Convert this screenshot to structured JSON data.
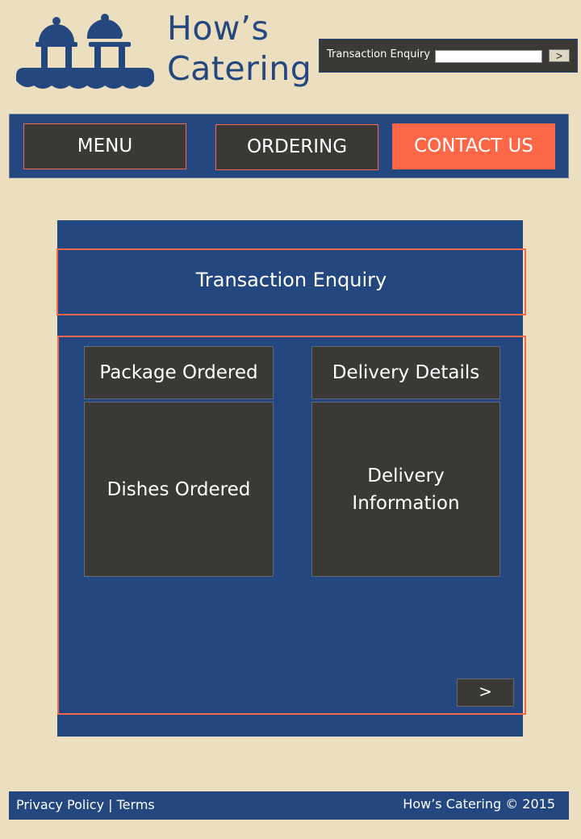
{
  "header": {
    "brand_line1": "How’s",
    "brand_line2": "Catering",
    "search": {
      "label": "Transaction Enquiry",
      "value": "",
      "go_label": ">"
    }
  },
  "nav": {
    "menu": "MENU",
    "ordering": "ORDERING",
    "contact": "CONTACT US"
  },
  "main": {
    "title": "Transaction Enquiry",
    "tiles": {
      "package": "Package Ordered",
      "delivery": "Delivery Details",
      "dishes": "Dishes Ordered",
      "info": "Delivery\nInformation"
    },
    "next_label": ">"
  },
  "footer": {
    "privacy": "Privacy Policy",
    "separator": "|",
    "terms": "Terms",
    "copyright": "How’s Catering © 2015"
  },
  "colors": {
    "background": "#ebdfbf",
    "primary_blue": "#23477e",
    "dark": "#3a3935",
    "accent": "#fc6748"
  },
  "icons": [
    "catering-logo-icon"
  ]
}
